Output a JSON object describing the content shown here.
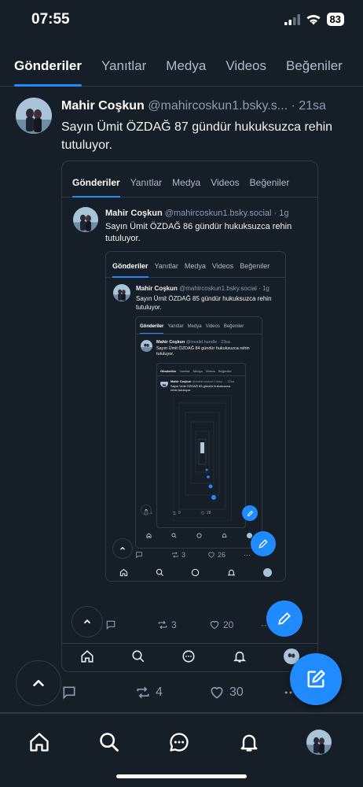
{
  "status_bar": {
    "time": "07:55",
    "battery": "83"
  },
  "tabs": [
    "Gönderiler",
    "Yanıtlar",
    "Medya",
    "Videos",
    "Beğeniler"
  ],
  "post": {
    "author": "Mahir Coşkun",
    "handle": "@mahircoskun1.bsky.s...",
    "time": "· 21sa",
    "text": "Sayın Ümit ÖZDAĞ 87 gündür hukuksuzca rehin tutuluyor.",
    "reply_count": "",
    "repost_count": "4",
    "like_count": "30"
  },
  "embed1": {
    "tabs": [
      "Gönderiler",
      "Yanıtlar",
      "Medya",
      "Videos",
      "Beğeniler"
    ],
    "author": "Mahir Coşkun",
    "handle": "@mahircoskun1.bsky.social",
    "time": "· 1g",
    "text": "Sayın Ümit ÖZDAĞ 86 gündür hukuksuzca rehin tutuluyor.",
    "repost_count": "3",
    "like_count": "20"
  },
  "embed2": {
    "tabs": [
      "Gönderiler",
      "Yanıtlar",
      "Medya",
      "Videos",
      "Beğeniler"
    ],
    "author": "Mahir Coşkun",
    "handle": "@mahircoskun1.bsky.social",
    "time": "· 1g",
    "text": "Sayın Ümit ÖZDAĞ 85 gündür hukuksuzca rehin tutuluyor.",
    "repost_count": "3",
    "like_count": "26"
  },
  "embed3": {
    "tabs": [
      "Gönderiler",
      "Yanıtlar",
      "Medya",
      "Videos",
      "Beğeniler"
    ],
    "author": "Mahir Coşkun",
    "handle": "@invalid.handle",
    "time": "· 23sa",
    "text": "Sayın Ümit ÖZDAĞ 84 gündür hukuksuzca rehin tutuluyor.",
    "repost_count": "9",
    "like_count": "28",
    "reply_count": "1"
  },
  "embed4": {
    "tabs": [
      "Gönderiler",
      "Yanıtlar",
      "Medya",
      "Videos",
      "Beğeniler"
    ],
    "author": "Mahir Coşkun",
    "handle": "@mahircoskun1.bsky...",
    "time": "· 22sa",
    "text": "Sayın Ümit ÖZDAĞ 83 gündür hukuksuzca rehin tutuluyor."
  },
  "colors": {
    "background": "#161e27",
    "accent": "#208bfe",
    "muted": "#8d9cae",
    "border": "#2e3a47"
  },
  "icons": {
    "nav": [
      "home-icon",
      "search-icon",
      "chat-icon",
      "bell-icon",
      "profile-avatar"
    ],
    "actions": [
      "reply-icon",
      "repost-icon",
      "like-icon",
      "more-icon"
    ],
    "fab": "compose-icon",
    "scroll_top": "chevron-up-icon"
  }
}
